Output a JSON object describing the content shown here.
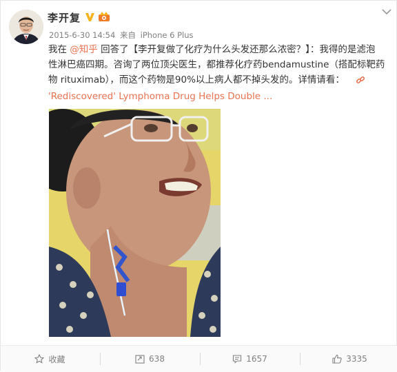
{
  "post": {
    "username": "李开复",
    "meta": {
      "date": "2015-6-30 14:54",
      "via_prefix": "来自",
      "device": "iPhone 6 Plus"
    },
    "text_lines": [
      [
        "我在 ",
        "@知乎",
        " 回答了【李开复做了化疗为什么头发还那么浓密？】：我得的是滤泡"
      ],
      [
        "性淋巴癌四期。咨询了两位顶尖医生，都推荐化疗药bendamustine（搭配标靶药"
      ],
      [
        "物 rituximab），而这个药物是90%以上病人都不掉头发的。详情请看："
      ]
    ],
    "link_text": "'Rediscovered' Lymphoma Drug Helps Double ..."
  },
  "actions": {
    "favorite": {
      "label": "收藏",
      "icon": "star-icon"
    },
    "repost": {
      "count": "638",
      "icon": "repost-icon"
    },
    "comment": {
      "count": "1657",
      "icon": "comment-icon"
    },
    "like": {
      "count": "3335",
      "icon": "thumbs-up-icon"
    }
  },
  "colors": {
    "link": "#eb7350",
    "meta": "#808080",
    "vbadge": "#f8b31c",
    "text": "#333333"
  }
}
